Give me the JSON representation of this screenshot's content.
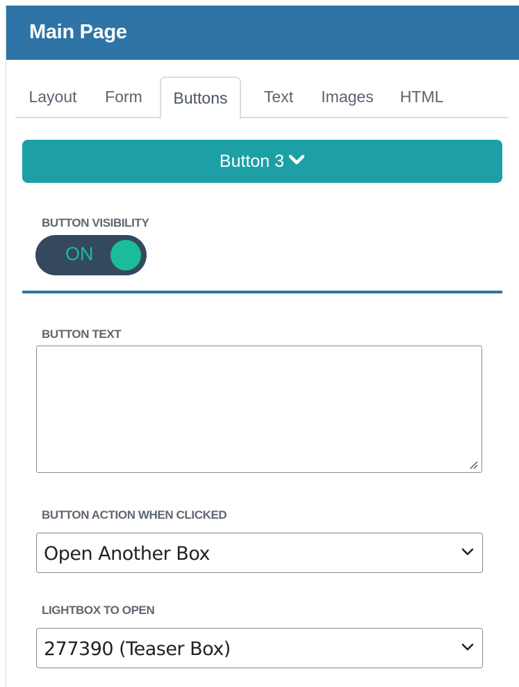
{
  "header": {
    "title": "Main Page"
  },
  "tabs": [
    {
      "label": "Layout"
    },
    {
      "label": "Form"
    },
    {
      "label": "Buttons",
      "active": true
    },
    {
      "label": "Text"
    },
    {
      "label": "Images"
    },
    {
      "label": "HTML"
    }
  ],
  "button_selector": {
    "label": "Button 3",
    "icon": "chevron-down-icon"
  },
  "visibility": {
    "label": "BUTTON VISIBILITY",
    "toggle_text": "ON"
  },
  "button_text": {
    "label": "BUTTON TEXT",
    "value": ""
  },
  "action": {
    "label": "BUTTON ACTION WHEN CLICKED",
    "selected": "Open Another Box"
  },
  "lightbox": {
    "label": "LIGHTBOX TO OPEN",
    "selected": "277390 (Teaser Box)"
  },
  "colors": {
    "header_bg": "#2e74a6",
    "accent_teal": "#1ca0a5",
    "toggle_bg": "#34495e",
    "toggle_on": "#1abc9c"
  }
}
